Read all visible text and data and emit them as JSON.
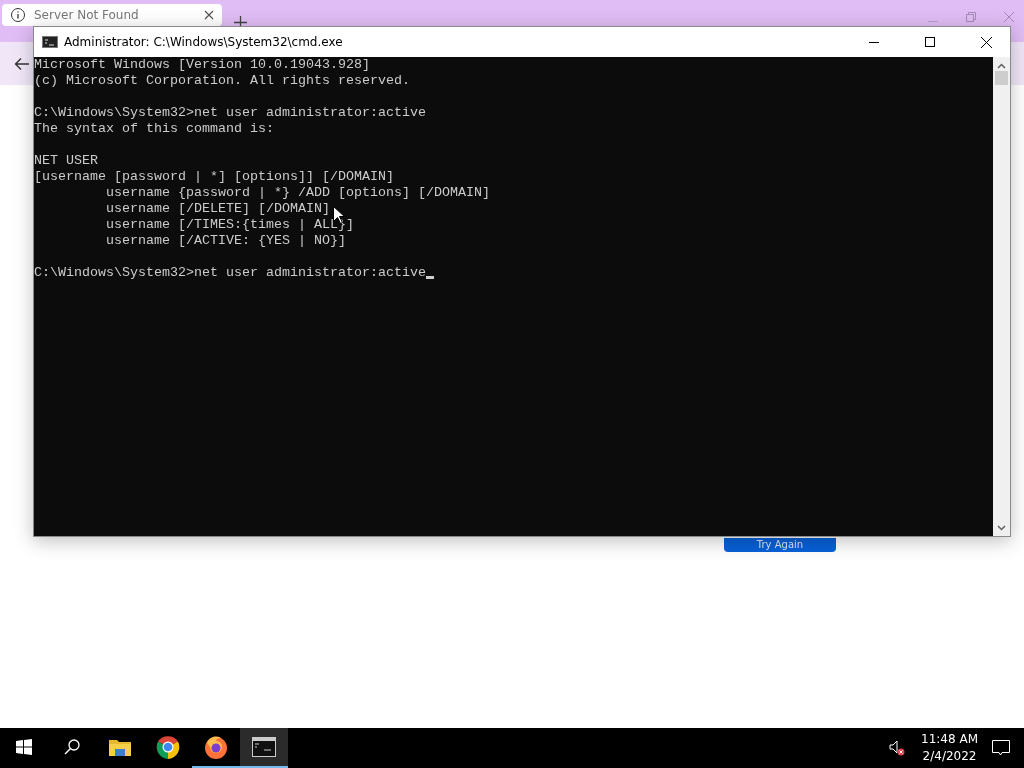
{
  "browser": {
    "tab": {
      "title": "Server Not Found",
      "selected": true
    },
    "button": "Try Again"
  },
  "console_window": {
    "title": "Administrator: C:\\Windows\\System32\\cmd.exe",
    "blocks": [
      [
        "Microsoft Windows [Version 10.0.19043.928]",
        "(c) Microsoft Corporation. All rights reserved."
      ],
      [
        "C:\\Windows\\System32>net user administrator:active",
        "The syntax of this command is:"
      ],
      [
        "NET USER",
        "[username [password | *] [options]] [/DOMAIN]",
        "         username {password | *} /ADD [options] [/DOMAIN]",
        "         username [/DELETE] [/DOMAIN]",
        "         username [/TIMES:{times | ALL}]",
        "         username [/ACTIVE: {YES | NO}]"
      ]
    ],
    "prompt": "C:\\Windows\\System32>net user administrator:active"
  },
  "taskbar": {
    "apps": [
      {
        "kind": "explorer",
        "running": false,
        "selected": false
      },
      {
        "kind": "chrome",
        "running": false,
        "selected": false
      },
      {
        "kind": "firefox",
        "running": true,
        "selected": false
      },
      {
        "kind": "console",
        "running": true,
        "selected": true
      }
    ],
    "volume_muted": true,
    "time": "11:48 AM",
    "date": "2/4/2022"
  }
}
